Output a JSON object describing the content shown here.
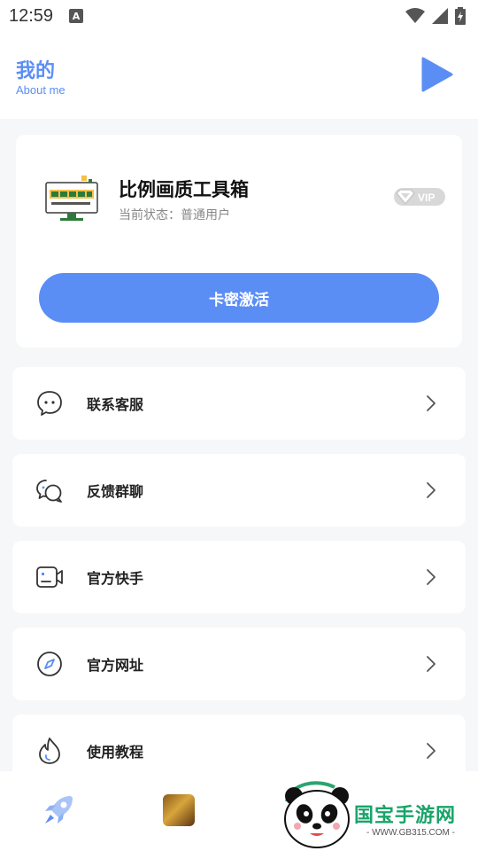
{
  "status_bar": {
    "time": "12:59",
    "notification_letter": "A"
  },
  "header": {
    "title": "我的",
    "subtitle": "About me",
    "play_icon": "play-icon"
  },
  "profile": {
    "app_name": "比例画质工具箱",
    "status": "当前状态：普通用户",
    "vip_badge": "VIP",
    "activate_label": "卡密激活"
  },
  "menu": [
    {
      "label": "联系客服",
      "icon": "chat-bubble-icon"
    },
    {
      "label": "反馈群聊",
      "icon": "group-chat-icon"
    },
    {
      "label": "官方快手",
      "icon": "video-camera-icon"
    },
    {
      "label": "官方网址",
      "icon": "compass-icon"
    },
    {
      "label": "使用教程",
      "icon": "flame-icon"
    }
  ],
  "watermark": {
    "text": "国宝手游网",
    "url": "- WWW.GB315.COM -"
  },
  "colors": {
    "accent": "#5b8ef5",
    "background": "#f6f7f9",
    "card": "#ffffff"
  }
}
